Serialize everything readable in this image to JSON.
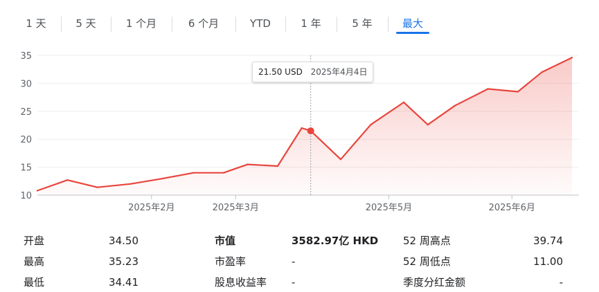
{
  "range_tabs": [
    {
      "label": "1 天",
      "active": false
    },
    {
      "label": "5 天",
      "active": false
    },
    {
      "label": "1 个月",
      "active": false
    },
    {
      "label": "6 个月",
      "active": false
    },
    {
      "label": "YTD",
      "active": false
    },
    {
      "label": "1 年",
      "active": false
    },
    {
      "label": "5 年",
      "active": false
    },
    {
      "label": "最大",
      "active": true
    }
  ],
  "tooltip": {
    "price": "21.50 USD",
    "date": "2025年4月4日"
  },
  "colors": {
    "line": "#e8453c",
    "accent": "#1a73e8"
  },
  "chart_data": {
    "type": "area",
    "x": [
      "2025-01-03",
      "2025-01-13",
      "2025-01-23",
      "2025-02-03",
      "2025-02-13",
      "2025-02-24",
      "2025-03-06",
      "2025-03-14",
      "2025-03-24",
      "2025-04-01",
      "2025-04-04",
      "2025-04-14",
      "2025-04-24",
      "2025-05-05",
      "2025-05-13",
      "2025-05-22",
      "2025-06-02",
      "2025-06-12",
      "2025-06-20",
      "2025-06-30"
    ],
    "values": [
      10.8,
      12.7,
      11.4,
      12.0,
      12.9,
      14.0,
      14.0,
      15.5,
      15.2,
      22.0,
      21.5,
      16.4,
      22.6,
      26.6,
      22.6,
      26.0,
      29.0,
      28.5,
      32.0,
      34.6
    ],
    "xtick_labels": [
      "2025年2月",
      "2025年3月",
      "2025年5月",
      "2025年6月"
    ],
    "xtick_dates": [
      "2025-02-10",
      "2025-03-10",
      "2025-04-30",
      "2025-06-10"
    ],
    "ytick_labels": [
      "35",
      "30",
      "25",
      "20",
      "15",
      "10"
    ],
    "ylim": [
      10,
      35
    ],
    "grid": true,
    "highlight": {
      "date": "2025-04-04",
      "value": 21.5
    }
  },
  "stats": {
    "col1": [
      {
        "label": "开盘",
        "value": "34.50"
      },
      {
        "label": "最高",
        "value": "35.23"
      },
      {
        "label": "最低",
        "value": "34.41"
      }
    ],
    "col2": [
      {
        "label": "市值",
        "value": "3582.97亿 HKD"
      },
      {
        "label": "市盈率",
        "value": "-"
      },
      {
        "label": "股息收益率",
        "value": "-"
      }
    ],
    "col3": [
      {
        "label": "52 周高点",
        "value": "39.74"
      },
      {
        "label": "52 周低点",
        "value": "11.00"
      },
      {
        "label": "季度分红金额",
        "value": "-"
      }
    ]
  }
}
